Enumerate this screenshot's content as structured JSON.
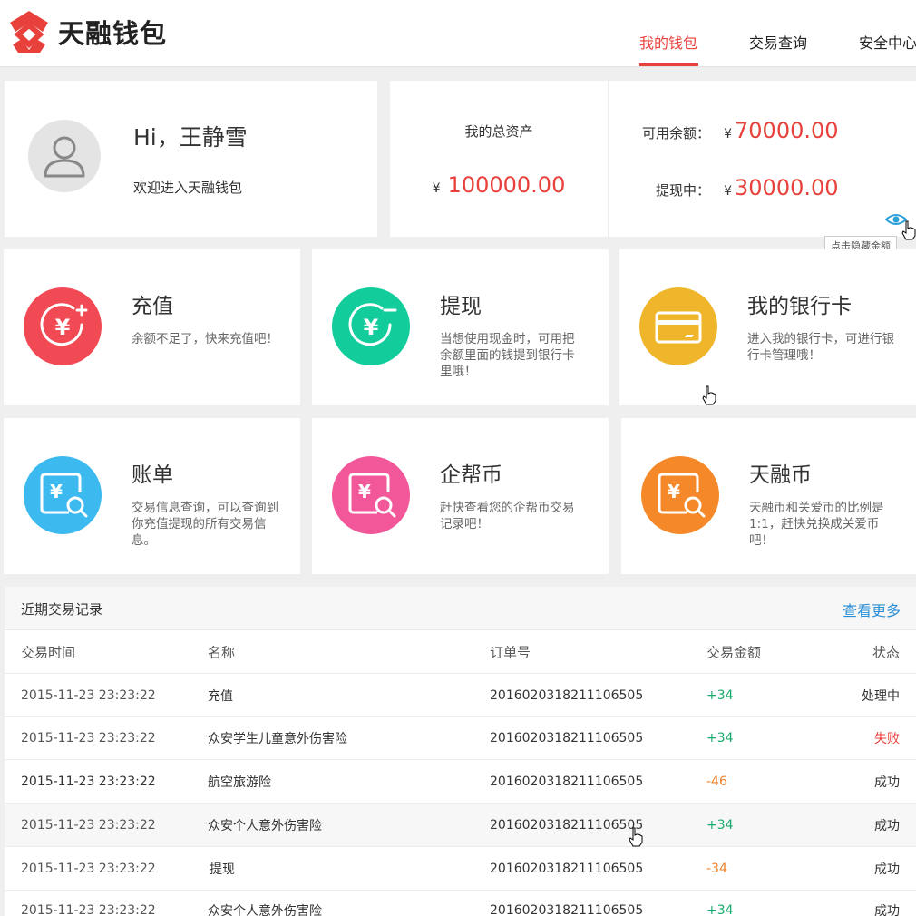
{
  "header": {
    "brand": "天融钱包",
    "nav": [
      {
        "label": "我的钱包",
        "active": true
      },
      {
        "label": "交易查询",
        "active": false
      },
      {
        "label": "安全中心",
        "active": false
      }
    ]
  },
  "profile": {
    "greeting": "Hi，王静雪",
    "welcome": "欢迎进入天融钱包"
  },
  "assets": {
    "total_label": "我的总资产",
    "currency": "¥",
    "total_value": "100000.00",
    "available_label": "可用余额：",
    "available_value": "70000.00",
    "withdrawing_label": "提现中：",
    "withdrawing_value": "30000.00",
    "hide_tooltip": "点击隐藏金额"
  },
  "features": [
    {
      "title": "充值",
      "desc": "余额不足了，快来充值吧！",
      "icon": "recharge-icon",
      "color": "#f24a55"
    },
    {
      "title": "提现",
      "desc": "当想使用现金时，可用把余额里面的钱提到银行卡里哦！",
      "icon": "withdraw-icon",
      "color": "#13cc9c"
    },
    {
      "title": "我的银行卡",
      "desc": "进入我的银行卡，可进行银行卡管理哦！",
      "icon": "bank-card-icon",
      "color": "#f0b62b"
    },
    {
      "title": "账单",
      "desc": "交易信息查询，可以查询到你充值提现的所有交易信息。",
      "icon": "bill-search-icon",
      "color": "#3cb9ef"
    },
    {
      "title": "企帮币",
      "desc": "赶快查看您的企帮币交易记录吧！",
      "icon": "coin-search-icon",
      "color": "#f2579a"
    },
    {
      "title": "天融币",
      "desc": "天融币和关爱币的比例是1:1，赶快兑换成关爱币吧！",
      "icon": "coin-exchange-icon",
      "color": "#f5892a"
    }
  ],
  "transactions": {
    "title": "近期交易记录",
    "more": "查看更多",
    "columns": [
      "交易时间",
      "名称",
      "订单号",
      "交易金额",
      "状态"
    ],
    "rows": [
      {
        "time": "2015-11-23 23:23:22",
        "name": "充值",
        "order": "2016020318211106505",
        "amount": "+34",
        "status": "处理中"
      },
      {
        "time": "2015-11-23 23:23:22",
        "name": "众安学生儿童意外伤害险",
        "order": "2016020318211106505",
        "amount": "+34",
        "status": "失败"
      },
      {
        "time": "2015-11-23 23:23:22",
        "name": "航空旅游险",
        "order": "2016020318211106505",
        "amount": "-46",
        "status": "成功"
      },
      {
        "time": "2015-11-23 23:23:22",
        "name": "众安个人意外伤害险",
        "order": "2016020318211106505",
        "amount": "+34",
        "status": "成功"
      },
      {
        "time": "2015-11-23 23:23:22",
        "name": "提现",
        "order": "2016020318211106505",
        "amount": "-34",
        "status": "成功"
      },
      {
        "time": "2015-11-23 23:23:22",
        "name": "众安个人意外伤害险",
        "order": "2016020318211106505",
        "amount": "+34",
        "status": "成功"
      }
    ]
  },
  "colors": {
    "accent": "#e8413b",
    "positive": "#1aaa6c",
    "negative": "#f0812b",
    "failed": "#e8413b",
    "link": "#2a8ed6"
  }
}
